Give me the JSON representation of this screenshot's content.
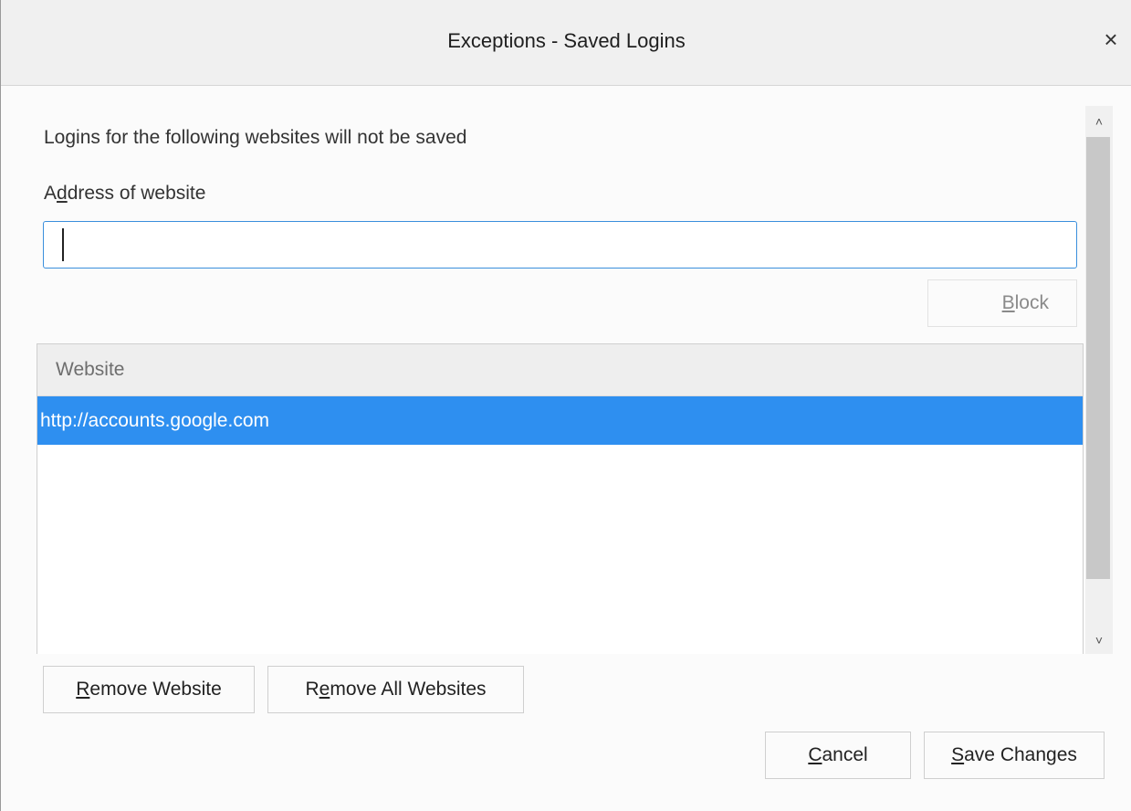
{
  "window": {
    "title": "Exceptions - Saved Logins",
    "close_glyph": "×"
  },
  "intro_text": "Logins for the following websites will not be saved",
  "address": {
    "label_pre": "A",
    "label_accel": "d",
    "label_post": "dress of website",
    "value": "",
    "placeholder": ""
  },
  "block_button": {
    "accel": "B",
    "rest": "lock"
  },
  "table": {
    "header": "Website",
    "rows": [
      {
        "website": "http://accounts.google.com",
        "selected": true
      }
    ]
  },
  "scrollbar": {
    "up_glyph": "˄",
    "down_glyph": "˅"
  },
  "buttons": {
    "remove_website": {
      "accel": "R",
      "rest": "emove Website"
    },
    "remove_all": {
      "pre": "R",
      "accel": "e",
      "rest": "move All Websites"
    },
    "cancel": {
      "accel": "C",
      "rest": "ancel"
    },
    "save": {
      "accel": "S",
      "rest": "ave Changes"
    }
  },
  "colors": {
    "selection": "#2e8ff0",
    "focus_border": "#3b8fdc"
  }
}
